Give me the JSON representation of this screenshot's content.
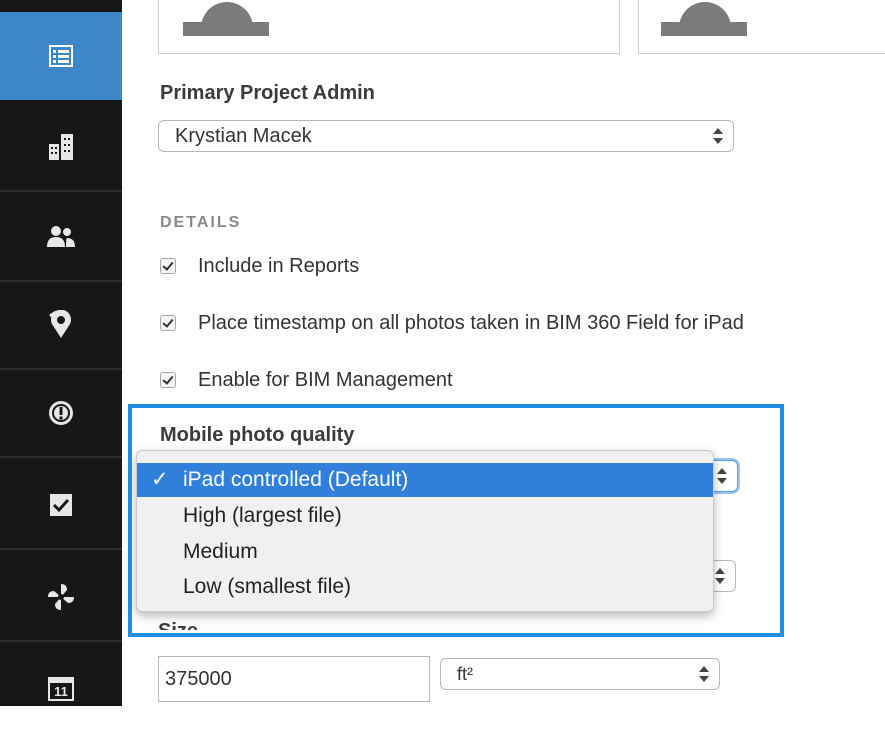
{
  "sidebar": {
    "items": [
      {
        "name": "list-icon",
        "active": true
      },
      {
        "name": "buildings-icon",
        "active": false
      },
      {
        "name": "people-icon",
        "active": false
      },
      {
        "name": "location-pin-icon",
        "active": false
      },
      {
        "name": "alert-icon",
        "active": false
      },
      {
        "name": "checkbox-icon",
        "active": false
      },
      {
        "name": "fan-icon",
        "active": false
      },
      {
        "name": "calendar-icon",
        "active": false,
        "number": "11"
      }
    ]
  },
  "admin": {
    "label": "Primary Project Admin",
    "value": "Krystian Macek"
  },
  "details": {
    "heading": "DETAILS",
    "checkboxes": [
      {
        "label": "Include in Reports",
        "checked": true
      },
      {
        "label": "Place timestamp on all photos taken in BIM 360 Field for iPad",
        "checked": true
      },
      {
        "label": "Enable for BIM Management",
        "checked": true
      }
    ]
  },
  "photo_quality": {
    "label": "Mobile photo quality",
    "options": [
      "iPad controlled (Default)",
      "High (largest file)",
      "Medium",
      "Low (smallest file)"
    ],
    "selected_index": 0,
    "check_mark": "✓"
  },
  "size": {
    "label": "Size",
    "value": "375000",
    "unit": "ft²"
  },
  "colors": {
    "sidebar_bg": "#161718",
    "sidebar_active": "#3d87c9",
    "highlight_border": "#1e8fe8",
    "menu_selected": "#2f7fdb"
  }
}
